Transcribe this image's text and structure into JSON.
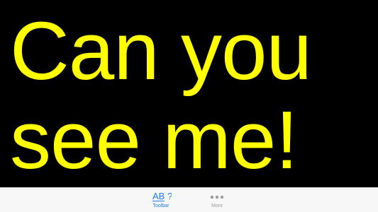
{
  "display": {
    "lines": [
      "Can you",
      "see me!"
    ],
    "text_color": "#ffff00",
    "background_color": "#000000"
  },
  "tabbar": {
    "items": [
      {
        "label": "Toolbar",
        "icon": "ab-question-icon",
        "icon_text": "AB ?",
        "active": true,
        "color": "#1a7cf0"
      },
      {
        "label": "More",
        "icon": "more-dots-icon",
        "active": false,
        "color": "#9b9b9b"
      }
    ]
  }
}
